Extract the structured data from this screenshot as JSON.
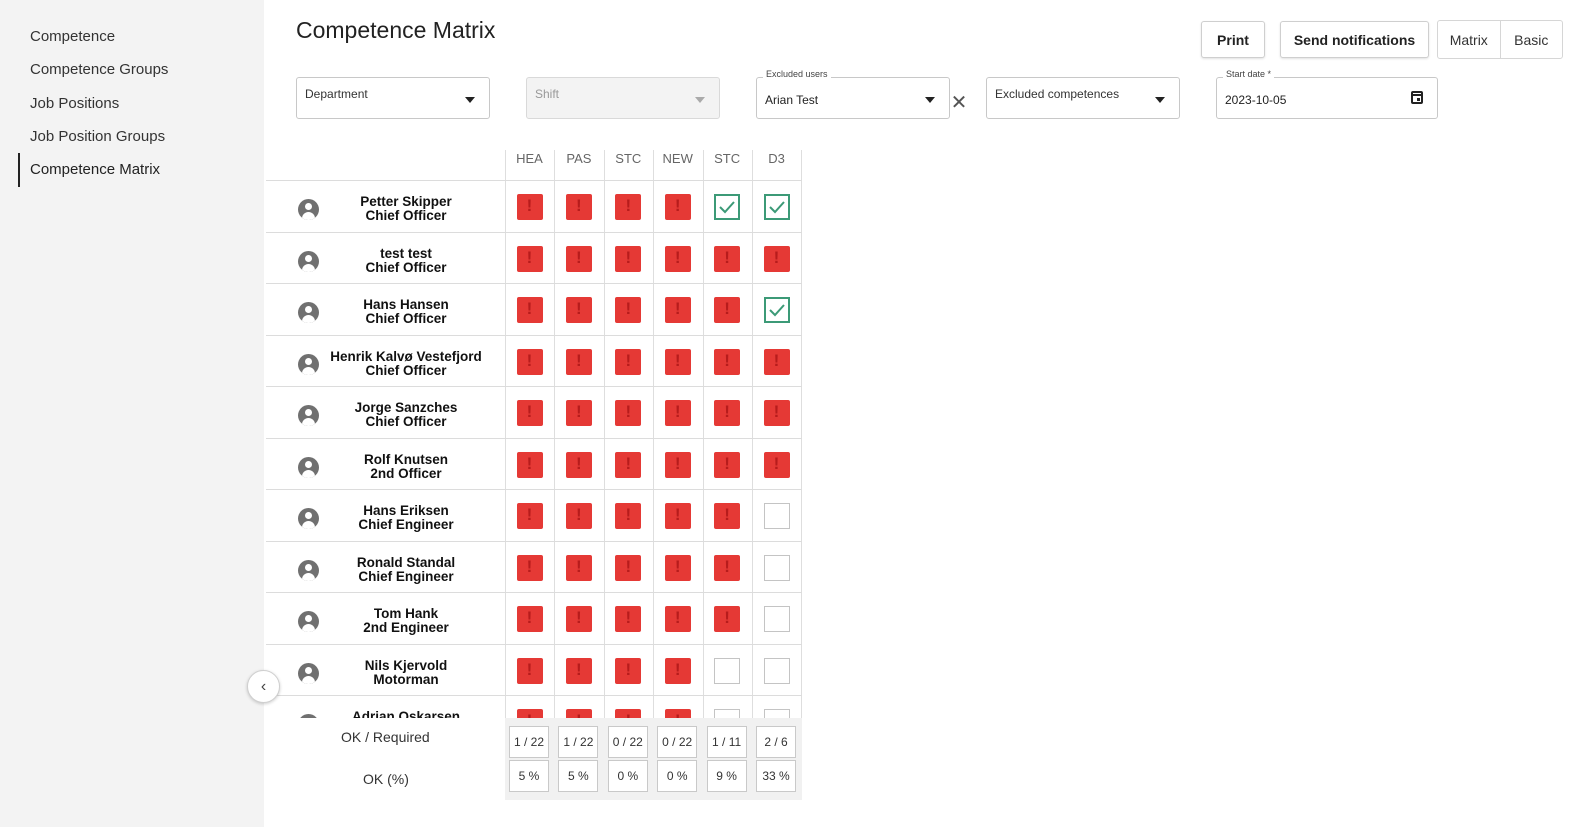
{
  "sidebar": {
    "items": [
      {
        "label": "Competence"
      },
      {
        "label": "Competence Groups"
      },
      {
        "label": "Job Positions"
      },
      {
        "label": "Job Position Groups"
      },
      {
        "label": "Competence Matrix",
        "active": true
      }
    ]
  },
  "header": {
    "title": "Competence Matrix",
    "print_label": "Print",
    "send_label": "Send notifications",
    "view_toggle": {
      "matrix": "Matrix",
      "basic": "Basic",
      "selected": "Matrix"
    }
  },
  "filters": {
    "department": {
      "placeholder": "Department"
    },
    "shift": {
      "placeholder": "Shift",
      "disabled": true
    },
    "excluded_users": {
      "label": "Excluded users",
      "value": "Arian Test"
    },
    "excluded_competences": {
      "placeholder": "Excluded competences"
    },
    "start_date": {
      "label": "Start date *",
      "value": "2023-10-05"
    }
  },
  "matrix": {
    "columns": [
      "HEA",
      "PAS",
      "STC",
      "NEW",
      "STC",
      "D3"
    ],
    "status_legend": {
      "warn": "#e53935",
      "ok": "#3c9a77",
      "empty": "#ffffff"
    },
    "rows": [
      {
        "name": "Petter Skipper",
        "role": "Chief Officer",
        "cells": [
          "warn",
          "warn",
          "warn",
          "warn",
          "ok",
          "ok"
        ]
      },
      {
        "name": "test test",
        "role": "Chief Officer",
        "cells": [
          "warn",
          "warn",
          "warn",
          "warn",
          "warn",
          "warn"
        ]
      },
      {
        "name": "Hans Hansen",
        "role": "Chief Officer",
        "cells": [
          "warn",
          "warn",
          "warn",
          "warn",
          "warn",
          "ok"
        ]
      },
      {
        "name": "Henrik Kalvø Vestefjord",
        "role": "Chief Officer",
        "cells": [
          "warn",
          "warn",
          "warn",
          "warn",
          "warn",
          "warn"
        ]
      },
      {
        "name": "Jorge Sanzches",
        "role": "Chief Officer",
        "cells": [
          "warn",
          "warn",
          "warn",
          "warn",
          "warn",
          "warn"
        ]
      },
      {
        "name": "Rolf Knutsen",
        "role": "2nd Officer",
        "cells": [
          "warn",
          "warn",
          "warn",
          "warn",
          "warn",
          "warn"
        ]
      },
      {
        "name": "Hans Eriksen",
        "role": "Chief Engineer",
        "cells": [
          "warn",
          "warn",
          "warn",
          "warn",
          "warn",
          "empty"
        ]
      },
      {
        "name": "Ronald Standal",
        "role": "Chief Engineer",
        "cells": [
          "warn",
          "warn",
          "warn",
          "warn",
          "warn",
          "empty"
        ]
      },
      {
        "name": "Tom Hank",
        "role": "2nd Engineer",
        "cells": [
          "warn",
          "warn",
          "warn",
          "warn",
          "warn",
          "empty"
        ]
      },
      {
        "name": "Nils Kjervold",
        "role": "Motorman",
        "cells": [
          "warn",
          "warn",
          "warn",
          "warn",
          "empty",
          "empty"
        ]
      },
      {
        "name": "Adrian Oskarsen",
        "role": "",
        "cells": [
          "warn",
          "warn",
          "warn",
          "warn",
          "empty",
          "empty"
        ]
      }
    ],
    "summary": {
      "ok_required_label": "OK / Required",
      "ok_percent_label": "OK (%)",
      "ok_required": [
        "1 / 22",
        "1 / 22",
        "0 / 22",
        "0 / 22",
        "1 / 11",
        "2 / 6"
      ],
      "ok_percent": [
        "5 %",
        "5 %",
        "0 %",
        "0 %",
        "9 %",
        "33 %"
      ]
    }
  }
}
